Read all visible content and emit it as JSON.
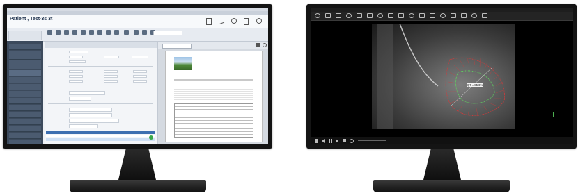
{
  "left_app": {
    "window_title": "",
    "tabs": [
      "",
      "",
      "",
      ""
    ],
    "patient": {
      "name": "Patient , Test-3s 3t",
      "details": [
        "",
        ""
      ]
    },
    "ribbon_groups": [
      "",
      "",
      "",
      "",
      "",
      "",
      "",
      "",
      ""
    ],
    "sidebar_items": [
      "",
      "",
      "",
      "",
      "",
      "",
      "",
      "",
      "",
      "",
      "",
      "",
      "",
      "",
      "",
      ""
    ],
    "form_title": "",
    "form_fields": [
      {
        "label": "",
        "value": ""
      },
      {
        "label": "",
        "value": ""
      },
      {
        "label": "",
        "value": ""
      },
      {
        "label": "",
        "value": ""
      },
      {
        "label": "",
        "value": ""
      },
      {
        "label": "",
        "value": ""
      },
      {
        "label": "",
        "value": ""
      },
      {
        "label": "",
        "value": ""
      },
      {
        "label": "",
        "value": ""
      },
      {
        "label": "",
        "value": ""
      },
      {
        "label": "",
        "value": ""
      },
      {
        "label": "",
        "value": ""
      },
      {
        "label": "",
        "value": ""
      },
      {
        "label": "",
        "value": ""
      }
    ],
    "doc_panel": {
      "heading": "",
      "table_rows": [
        "",
        "",
        "",
        "",
        "",
        "",
        "",
        "",
        "",
        "",
        "",
        "",
        "",
        ""
      ]
    },
    "bottom_table": {
      "header": [
        "",
        "",
        "",
        "",
        "",
        ""
      ],
      "rows": [
        [
          "",
          "",
          "",
          "",
          "",
          ""
        ],
        [
          "",
          "",
          "",
          "",
          "",
          ""
        ]
      ]
    }
  },
  "right_app": {
    "menu": [
      "",
      "",
      "",
      "",
      "",
      "",
      "",
      "",
      "",
      ""
    ],
    "overlay_top_left": [
      "",
      "",
      "",
      ""
    ],
    "overlay_top_right": [
      "",
      "",
      ""
    ],
    "measure_label": "Q7 = 85.6%",
    "overlay_bottom_left": [
      "",
      "",
      "",
      ""
    ],
    "overlay_bottom_right": [
      "",
      "",
      "",
      ""
    ],
    "toolbar_icons": [
      "select-icon",
      "pan-icon",
      "zoom-icon",
      "window-level-icon",
      "ruler-icon",
      "angle-icon",
      "roi-icon",
      "text-icon",
      "grid-icon",
      "layout-icon",
      "invert-icon",
      "rotate-icon",
      "flip-icon",
      "reset-icon",
      "cine-icon",
      "export-icon",
      "print-icon"
    ],
    "playback_icons": [
      "prev-icon",
      "play-icon",
      "next-icon",
      "stop-icon"
    ]
  },
  "colors": {
    "accent_blue": "#3d6fb0",
    "sidebar_dark": "#3c4a5c",
    "measure_red": "#d43a3a",
    "measure_green": "#5fd05f"
  }
}
